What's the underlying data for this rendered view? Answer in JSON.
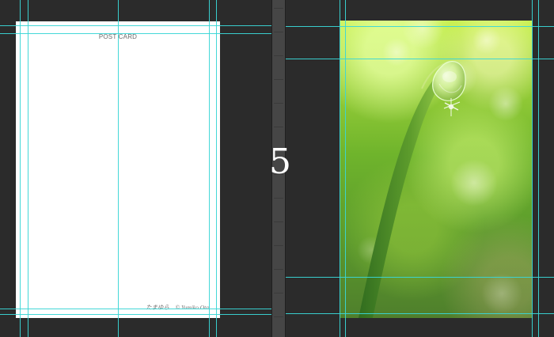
{
  "document": {
    "page_number": "5",
    "left_page": {
      "kind": "postcard",
      "title": "POST CARD",
      "credit": "たまゆら　© Yumiko Ota"
    },
    "right_page": {
      "kind": "photo",
      "subject": "dewdrop-on-grass-blade"
    }
  },
  "colors": {
    "canvas": "#2b2b2b",
    "divider": "#464646",
    "guide": "#3ad6d6",
    "page": "#ffffff",
    "accent_green": "#9ed23a"
  }
}
